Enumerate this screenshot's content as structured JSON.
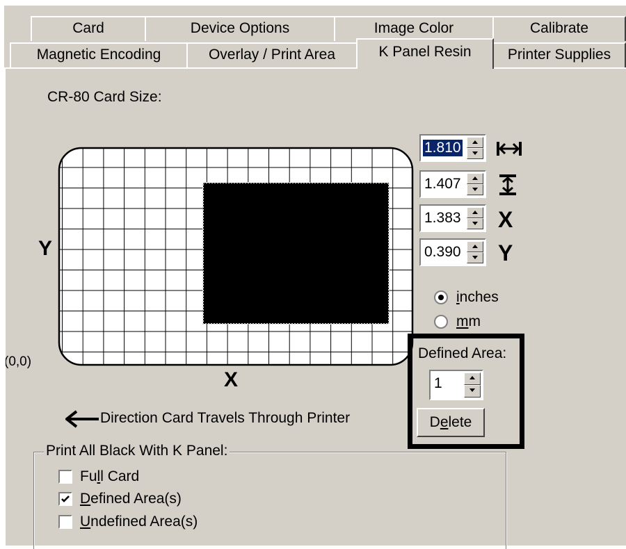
{
  "tabs_row1": [
    "Card",
    "Device Options",
    "Image Color",
    "Calibrate"
  ],
  "tabs_row2": [
    "Magnetic Encoding",
    "Overlay / Print Area",
    "K Panel Resin",
    "Printer Supplies"
  ],
  "active_tab": "K Panel Resin",
  "card_size_label": "CR-80 Card Size:",
  "card": {
    "y_label": "Y",
    "x_label": "X",
    "origin_label": "(0,0)",
    "direction_text": "Direction Card Travels Through Printer"
  },
  "fields": {
    "width": "1.810",
    "height": "1.407",
    "x": "1.383",
    "y": "0.390",
    "x_symbol": "X",
    "y_symbol": "Y"
  },
  "units": {
    "inches_pre": "",
    "inches_ul": "i",
    "inches_post": "nches",
    "mm_ul": "m",
    "mm_post": "m",
    "selected": "inches"
  },
  "defined_area": {
    "label": "Defined Area:",
    "value": "1",
    "delete_pre": "D",
    "delete_ul": "e",
    "delete_post": "lete"
  },
  "print_black": {
    "group_label": "Print All Black With K Panel:",
    "options": [
      {
        "pre": "Fu",
        "ul": "l",
        "post": "l Card",
        "checked": false
      },
      {
        "pre": "",
        "ul": "D",
        "post": "efined Area(s)",
        "checked": true
      },
      {
        "pre": "",
        "ul": "U",
        "post": "ndefined Area(s)",
        "checked": false
      }
    ]
  },
  "icons": {
    "width": "width-arrows-icon",
    "height": "height-arrows-icon",
    "direction": "left-arrow-icon"
  }
}
